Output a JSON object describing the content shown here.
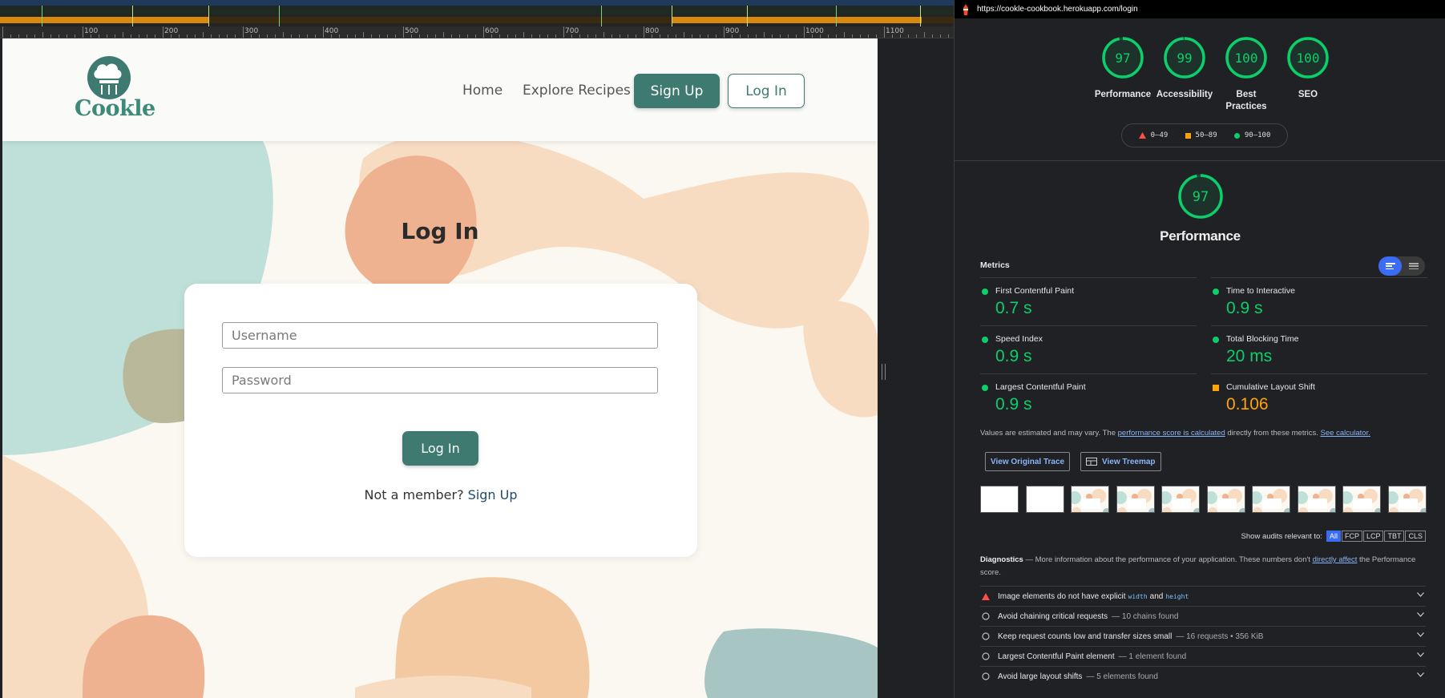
{
  "site": {
    "logo_text": "Cookle",
    "nav": {
      "home": "Home",
      "explore": "Explore Recipes",
      "signup": "Sign Up",
      "login": "Log In"
    },
    "page_title": "Log In",
    "form": {
      "username_placeholder": "Username",
      "password_placeholder": "Password",
      "submit": "Log In",
      "footer_text": "Not a member?",
      "footer_link": "Sign Up"
    },
    "colors": {
      "primary": "#3e7a70",
      "background": "#fbf8f2"
    }
  },
  "ruler": {
    "labels": [
      "100",
      "200",
      "300",
      "400",
      "500",
      "600",
      "700",
      "800",
      "900",
      "1000",
      "1100"
    ]
  },
  "lighthouse": {
    "url": "https://cookle-cookbook.herokuapp.com/login",
    "scores": [
      {
        "value": "97",
        "label": "Performance",
        "score": 97
      },
      {
        "value": "99",
        "label": "Accessibility",
        "score": 99
      },
      {
        "value": "100",
        "label": "Best Practices",
        "score": 100
      },
      {
        "value": "100",
        "label": "SEO",
        "score": 100
      }
    ],
    "legend": [
      {
        "range": "0–49",
        "color": "#ff4e42"
      },
      {
        "range": "50–89",
        "color": "#ffa400"
      },
      {
        "range": "90–100",
        "color": "#0cce6b"
      }
    ],
    "main_score": {
      "value": "97",
      "label": "Performance",
      "score": 97
    },
    "metrics_heading": "Metrics",
    "metrics": [
      {
        "name": "First Contentful Paint",
        "value": "0.7 s",
        "status": "pass"
      },
      {
        "name": "Time to Interactive",
        "value": "0.9 s",
        "status": "pass"
      },
      {
        "name": "Speed Index",
        "value": "0.9 s",
        "status": "pass"
      },
      {
        "name": "Total Blocking Time",
        "value": "20 ms",
        "status": "pass"
      },
      {
        "name": "Largest Contentful Paint",
        "value": "0.9 s",
        "status": "pass"
      },
      {
        "name": "Cumulative Layout Shift",
        "value": "0.106",
        "status": "average"
      }
    ],
    "note": {
      "prefix": "Values are estimated and may vary. The",
      "link1": "performance score is calculated",
      "middle": "directly from these metrics.",
      "link2": "See calculator."
    },
    "buttons": {
      "trace": "View Original Trace",
      "treemap": "View Treemap"
    },
    "filter": {
      "label": "Show audits relevant to:",
      "options": [
        "All",
        "FCP",
        "LCP",
        "TBT",
        "CLS"
      ],
      "selected": "All"
    },
    "diagnostics": {
      "title": "Diagnostics",
      "text": "— More information about the performance of your application. These numbers don't",
      "link": "directly affect",
      "tail": "the Performance score."
    },
    "audits": [
      {
        "icon": "fail",
        "title": "Image elements do not have explicit",
        "code1": "width",
        "and": "and",
        "code2": "height",
        "meta": ""
      },
      {
        "icon": "info",
        "title": "Avoid chaining critical requests",
        "meta": "— 10 chains found"
      },
      {
        "icon": "info",
        "title": "Keep request counts low and transfer sizes small",
        "meta": "— 16 requests • 356 KiB"
      },
      {
        "icon": "info",
        "title": "Largest Contentful Paint element",
        "meta": "— 1 element found"
      },
      {
        "icon": "info",
        "title": "Avoid large layout shifts",
        "meta": "— 5 elements found"
      }
    ]
  }
}
